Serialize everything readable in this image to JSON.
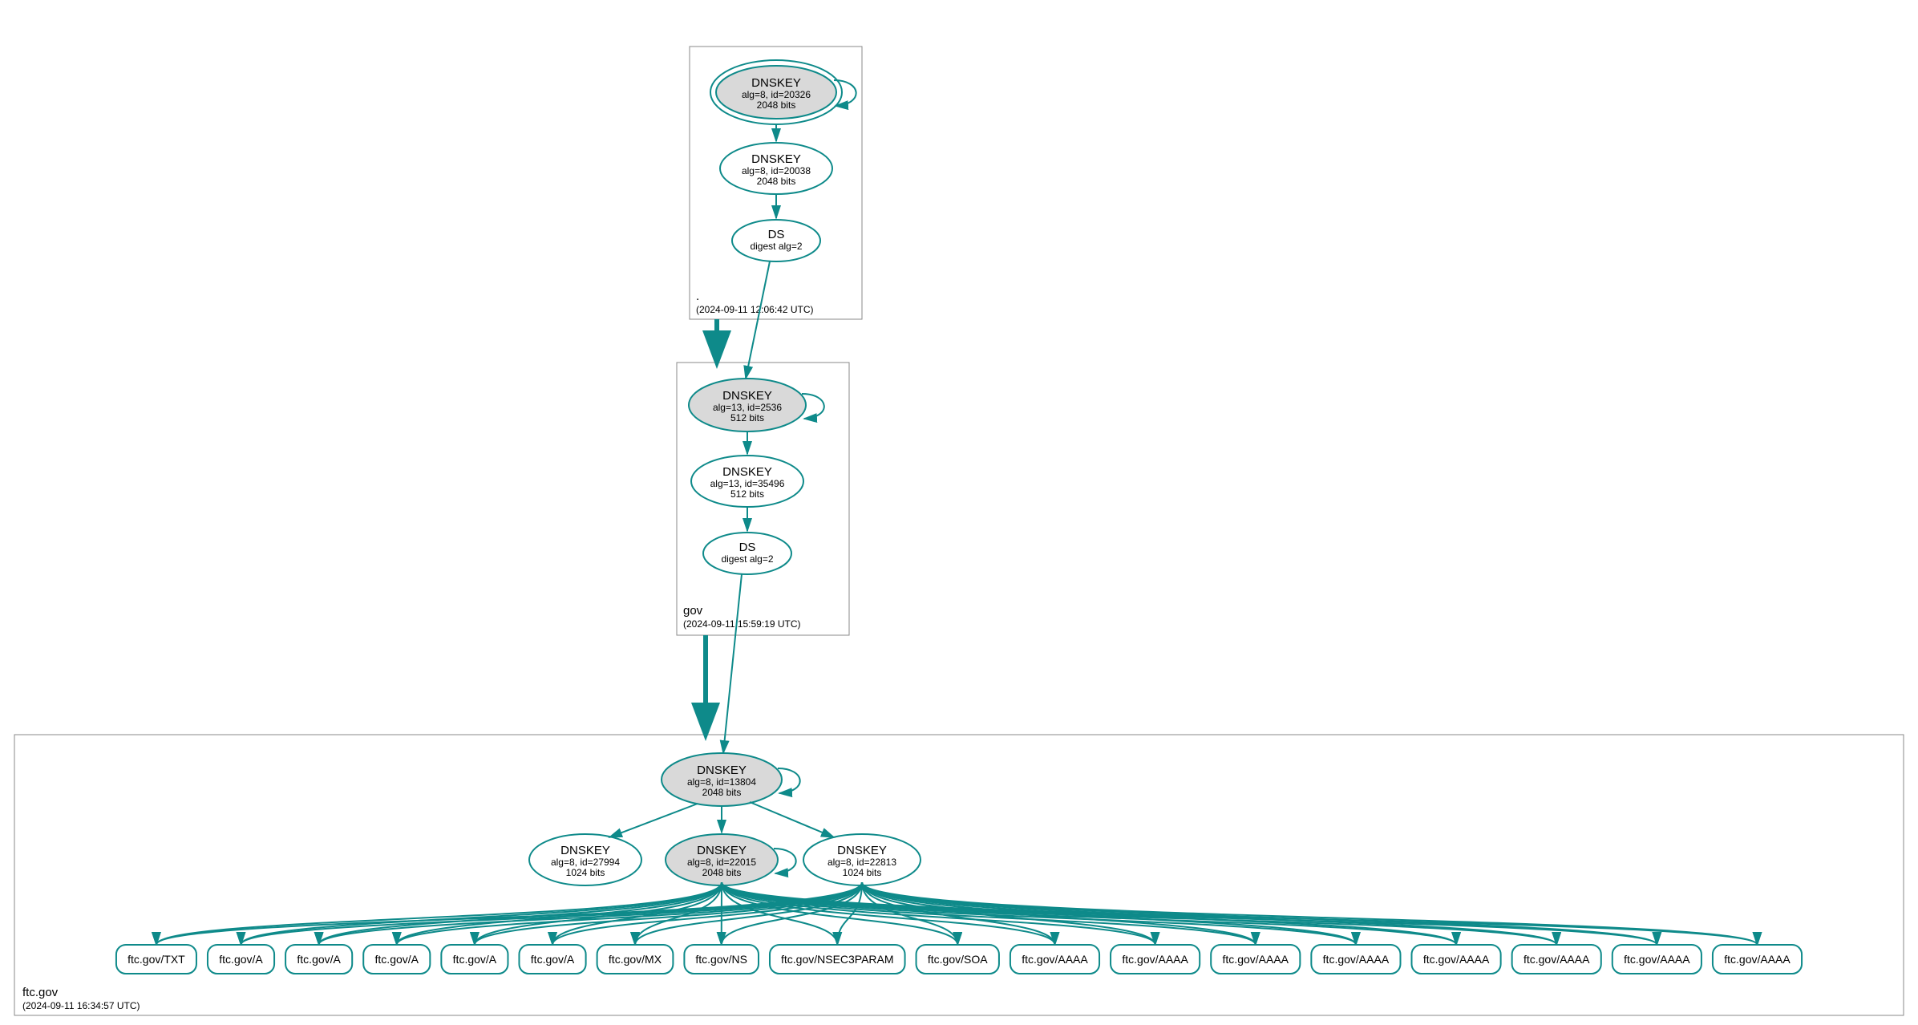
{
  "zones": {
    "root": {
      "label": ".",
      "timestamp": "(2024-09-11 12:06:42 UTC)"
    },
    "gov": {
      "label": "gov",
      "timestamp": "(2024-09-11 15:59:19 UTC)"
    },
    "ftc": {
      "label": "ftc.gov",
      "timestamp": "(2024-09-11 16:34:57 UTC)"
    }
  },
  "nodes": {
    "root_k1": {
      "title": "DNSKEY",
      "l2": "alg=8, id=20326",
      "l3": "2048 bits"
    },
    "root_k2": {
      "title": "DNSKEY",
      "l2": "alg=8, id=20038",
      "l3": "2048 bits"
    },
    "root_ds": {
      "title": "DS",
      "l2": "digest alg=2"
    },
    "gov_k1": {
      "title": "DNSKEY",
      "l2": "alg=13, id=2536",
      "l3": "512 bits"
    },
    "gov_k2": {
      "title": "DNSKEY",
      "l2": "alg=13, id=35496",
      "l3": "512 bits"
    },
    "gov_ds": {
      "title": "DS",
      "l2": "digest alg=2"
    },
    "ftc_k1": {
      "title": "DNSKEY",
      "l2": "alg=8, id=13804",
      "l3": "2048 bits"
    },
    "ftc_k2": {
      "title": "DNSKEY",
      "l2": "alg=8, id=27994",
      "l3": "1024 bits"
    },
    "ftc_k3": {
      "title": "DNSKEY",
      "l2": "alg=8, id=22015",
      "l3": "2048 bits"
    },
    "ftc_k4": {
      "title": "DNSKEY",
      "l2": "alg=8, id=22813",
      "l3": "1024 bits"
    }
  },
  "leaves": [
    "ftc.gov/TXT",
    "ftc.gov/A",
    "ftc.gov/A",
    "ftc.gov/A",
    "ftc.gov/A",
    "ftc.gov/A",
    "ftc.gov/MX",
    "ftc.gov/NS",
    "ftc.gov/NSEC3PARAM",
    "ftc.gov/SOA",
    "ftc.gov/AAAA",
    "ftc.gov/AAAA",
    "ftc.gov/AAAA",
    "ftc.gov/AAAA",
    "ftc.gov/AAAA",
    "ftc.gov/AAAA",
    "ftc.gov/AAAA",
    "ftc.gov/AAAA"
  ]
}
